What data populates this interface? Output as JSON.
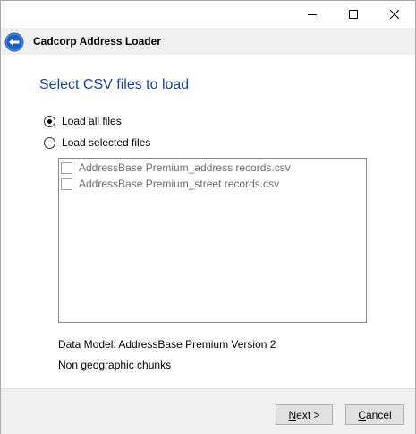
{
  "window": {
    "title": "Cadcorp Address Loader"
  },
  "page": {
    "heading": "Select CSV files to load"
  },
  "options": {
    "load_all": {
      "label": "Load all files",
      "selected": true
    },
    "load_selected": {
      "label": "Load selected files",
      "selected": false
    }
  },
  "files": [
    {
      "name": "AddressBase Premium_address records.csv",
      "checked": false
    },
    {
      "name": "AddressBase Premium_street records.csv",
      "checked": false
    }
  ],
  "info": {
    "data_model": "Data Model: AddressBase Premium Version 2",
    "chunks": "Non geographic chunks"
  },
  "buttons": {
    "next_mnemonic": "N",
    "next_rest": "ext >",
    "cancel_mnemonic": "C",
    "cancel_rest": "ancel"
  },
  "colors": {
    "heading": "#1e3f9c",
    "back_button": "#1c5fc4",
    "header_bg": "#f0f0f0",
    "disabled_text": "#6d6d6d"
  },
  "icons": [
    "minimize-icon",
    "maximize-icon",
    "close-icon",
    "back-arrow-icon"
  ]
}
